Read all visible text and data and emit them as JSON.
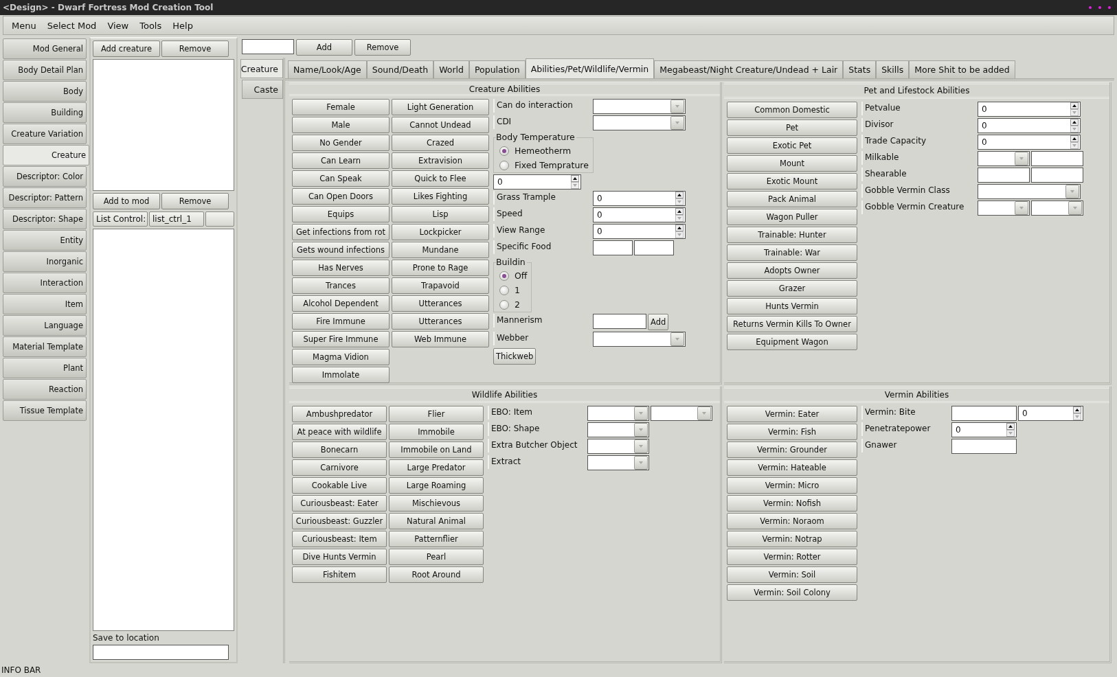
{
  "window": {
    "title": "<Design> - Dwarf Fortress Mod Creation Tool"
  },
  "menu": [
    "Menu",
    "Select Mod",
    "View",
    "Tools",
    "Help"
  ],
  "sidebar": {
    "items": [
      {
        "label": "Mod General",
        "selected": false
      },
      {
        "label": "Body Detail Plan",
        "selected": false
      },
      {
        "label": "Body",
        "selected": false
      },
      {
        "label": "Building",
        "selected": false
      },
      {
        "label": "Creature Variation",
        "selected": false
      },
      {
        "label": "Creature",
        "selected": true
      },
      {
        "label": "Descriptor: Color",
        "selected": false
      },
      {
        "label": "Descriptor: Pattern",
        "selected": false
      },
      {
        "label": "Descriptor: Shape",
        "selected": false
      },
      {
        "label": "Entity",
        "selected": false
      },
      {
        "label": "Inorganic",
        "selected": false
      },
      {
        "label": "Interaction",
        "selected": false
      },
      {
        "label": "Item",
        "selected": false
      },
      {
        "label": "Language",
        "selected": false
      },
      {
        "label": "Material Template",
        "selected": false
      },
      {
        "label": "Plant",
        "selected": false
      },
      {
        "label": "Reaction",
        "selected": false
      },
      {
        "label": "Tissue Template",
        "selected": false
      }
    ]
  },
  "creature_list": {
    "top_buttons": [
      "Add creature",
      "Remove"
    ],
    "mod_buttons": [
      "Add to mod",
      "Remove"
    ],
    "list_control": {
      "label": "List Control:",
      "value": "list_ctrl_1"
    },
    "save": {
      "label": "Save to location"
    }
  },
  "toolbar": {
    "buttons": [
      "Add",
      "Remove"
    ]
  },
  "side_tabs": [
    {
      "label": "Creature",
      "selected": true
    },
    {
      "label": "Caste",
      "selected": false
    }
  ],
  "tabs": [
    {
      "label": "Name/Look/Age",
      "selected": false
    },
    {
      "label": "Sound/Death",
      "selected": false
    },
    {
      "label": "World",
      "selected": false
    },
    {
      "label": "Population",
      "selected": false
    },
    {
      "label": "Abilities/Pet/Wildlife/Vermin",
      "selected": true
    },
    {
      "label": "Megabeast/Night Creature/Undead + Lair",
      "selected": false
    },
    {
      "label": "Stats",
      "selected": false
    },
    {
      "label": "Skills",
      "selected": false
    },
    {
      "label": "More Shit to be added",
      "selected": false
    }
  ],
  "sections": [
    {
      "title": "Creature Abilities",
      "button_columns": [
        [
          "Female",
          "Male",
          "No Gender",
          "Can Learn",
          "Can Speak",
          "Can Open Doors",
          "Equips",
          "Get infections from rot",
          "Gets wound infections",
          "Has Nerves",
          "Trances",
          "Alcohol Dependent",
          "Fire Immune",
          "Super Fire Immune",
          "Magma Vidion",
          "Immolate"
        ],
        [
          "Light Generation",
          "Cannot Undead",
          "Crazed",
          "Extravision",
          "Quick to Flee",
          "Likes Fighting",
          "Lisp",
          "Lockpicker",
          "Mundane",
          "Prone to Rage",
          "Trapavoid",
          "Utterances",
          "Utterances",
          "Web Immune"
        ]
      ],
      "fields": [
        {
          "kind": "row",
          "label": "Can do interaction",
          "controls": [
            {
              "kind": "combo"
            }
          ]
        },
        {
          "kind": "row",
          "label": "CDI",
          "controls": [
            {
              "kind": "combo"
            }
          ]
        },
        {
          "kind": "radios",
          "title": "Body Temperature",
          "options": [
            {
              "label": "Hemeotherm",
              "selected": true
            },
            {
              "label": "Fixed Temprature",
              "selected": false
            }
          ]
        },
        {
          "kind": "spin",
          "value": "0"
        },
        {
          "kind": "row",
          "label": "Grass Trample",
          "controls": [
            {
              "kind": "spin",
              "value": "0"
            }
          ]
        },
        {
          "kind": "row",
          "label": "Speed",
          "controls": [
            {
              "kind": "spin",
              "value": "0"
            }
          ]
        },
        {
          "kind": "row",
          "label": "View Range",
          "controls": [
            {
              "kind": "spin",
              "value": "0"
            }
          ]
        },
        {
          "kind": "row",
          "label": "Specific Food",
          "controls": [
            {
              "kind": "text"
            },
            {
              "kind": "text"
            }
          ]
        },
        {
          "kind": "radios",
          "title": "Buildin",
          "options": [
            {
              "label": "Off",
              "selected": true
            },
            {
              "label": "1",
              "selected": false
            },
            {
              "label": "2",
              "selected": false
            }
          ]
        },
        {
          "kind": "row",
          "label": "Mannerism",
          "controls": [
            {
              "kind": "text"
            },
            {
              "kind": "button",
              "label": "Add"
            }
          ]
        },
        {
          "kind": "row",
          "label": "Webber",
          "controls": [
            {
              "kind": "combo"
            }
          ]
        },
        {
          "kind": "button",
          "label": "Thickweb"
        }
      ]
    },
    {
      "title": "Pet and Lifestock Abilities",
      "button_columns": [
        [
          "Common Domestic",
          "Pet",
          "Exotic Pet",
          "Mount",
          "Exotic Mount",
          "Pack Animal",
          "Wagon Puller",
          "Trainable: Hunter",
          "Trainable: War",
          "Adopts Owner",
          "Grazer",
          "Hunts Vermin",
          "Returns Vermin Kills To Owner",
          "Equipment Wagon"
        ]
      ],
      "fields": [
        {
          "kind": "row",
          "label": "Petvalue",
          "controls": [
            {
              "kind": "spin",
              "value": "0"
            }
          ]
        },
        {
          "kind": "row",
          "label": "Divisor",
          "controls": [
            {
              "kind": "spin",
              "value": "0"
            }
          ]
        },
        {
          "kind": "row",
          "label": "Trade Capacity",
          "controls": [
            {
              "kind": "spin",
              "value": "0"
            }
          ]
        },
        {
          "kind": "row",
          "label": "Milkable",
          "controls": [
            {
              "kind": "combo"
            },
            {
              "kind": "text"
            }
          ]
        },
        {
          "kind": "row",
          "label": "Shearable",
          "controls": [
            {
              "kind": "text"
            },
            {
              "kind": "text"
            }
          ]
        },
        {
          "kind": "row",
          "label": "Gobble Vermin Class",
          "controls": [
            {
              "kind": "combo"
            }
          ]
        },
        {
          "kind": "row",
          "label": "Gobble Vermin Creature",
          "controls": [
            {
              "kind": "combo"
            },
            {
              "kind": "combo"
            }
          ]
        }
      ]
    },
    {
      "title": "Wildlife Abilities",
      "button_columns": [
        [
          "Ambushpredator",
          "At peace with wildlife",
          "Bonecarn",
          "Carnivore",
          "Cookable Live",
          "Curiousbeast: Eater",
          "Curiousbeast: Guzzler",
          "Curiousbeast: Item",
          "Dive Hunts Vermin",
          "Fishitem"
        ],
        [
          "Flier",
          "Immobile",
          "Immobile on Land",
          "Large Predator",
          "Large Roaming",
          "Mischievous",
          "Natural Animal",
          "Patternflier",
          "Pearl",
          "Root Around"
        ]
      ],
      "fields": [
        {
          "kind": "row",
          "label": "EBO: Item",
          "controls": [
            {
              "kind": "combo"
            },
            {
              "kind": "combo"
            }
          ]
        },
        {
          "kind": "row",
          "label": "EBO: Shape",
          "controls": [
            {
              "kind": "combo"
            }
          ]
        },
        {
          "kind": "row",
          "label": "Extra Butcher Object",
          "controls": [
            {
              "kind": "combo"
            }
          ]
        },
        {
          "kind": "row",
          "label": "Extract",
          "controls": [
            {
              "kind": "combo"
            }
          ]
        }
      ]
    },
    {
      "title": "Vermin Abilities",
      "button_columns": [
        [
          "Vermin: Eater",
          "Vermin: Fish",
          "Vermin: Grounder",
          "Vermin: Hateable",
          "Vermin: Micro",
          "Vermin: Nofish",
          "Vermin: Noraom",
          "Vermin: Notrap",
          "Vermin: Rotter",
          "Vermin: Soil",
          "Vermin: Soil Colony"
        ]
      ],
      "fields": [
        {
          "kind": "row",
          "label": "Vermin: Bite",
          "controls": [
            {
              "kind": "text"
            },
            {
              "kind": "spin",
              "value": "0"
            }
          ]
        },
        {
          "kind": "row",
          "label": "Penetratepower",
          "controls": [
            {
              "kind": "spin",
              "value": "0"
            }
          ]
        },
        {
          "kind": "row",
          "label": "Gnawer",
          "controls": [
            {
              "kind": "text"
            }
          ]
        }
      ]
    }
  ],
  "status_bar": {
    "text": "INFO BAR"
  }
}
